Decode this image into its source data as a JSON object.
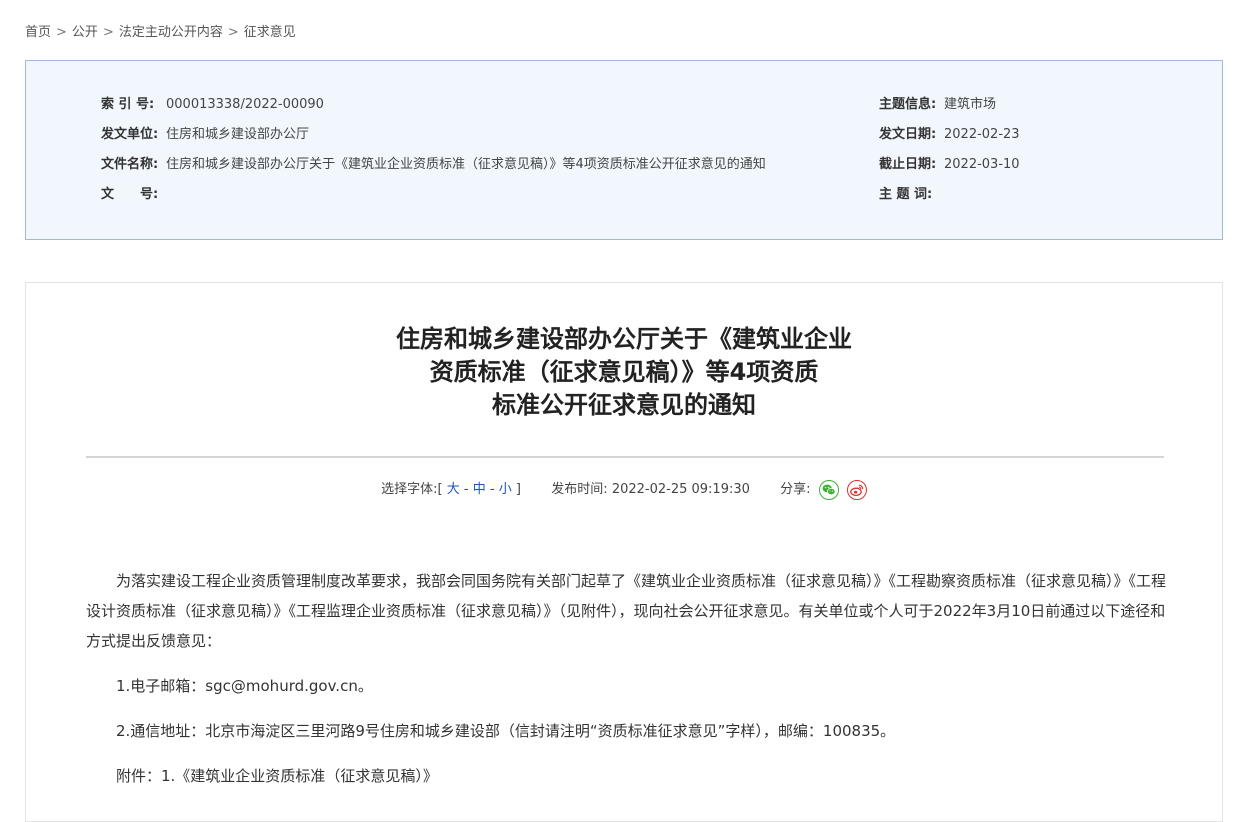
{
  "breadcrumb": {
    "items": [
      "首页",
      "公开",
      "法定主动公开内容",
      "征求意见"
    ],
    "separator": ">"
  },
  "meta": {
    "index_label": "索 引 号:",
    "index_value": "000013338/2022-00090",
    "issuer_label": "发文单位:",
    "issuer_value": "住房和城乡建设部办公厅",
    "filename_label": "文件名称:",
    "filename_value": "住房和城乡建设部办公厅关于《建筑业企业资质标准（征求意见稿）》等4项资质标准公开征求意见的通知",
    "docno_label": "文　　号:",
    "docno_value": "",
    "topic_label": "主题信息:",
    "topic_value": "建筑市场",
    "date_label": "发文日期:",
    "date_value": "2022-02-23",
    "deadline_label": "截止日期:",
    "deadline_value": "2022-03-10",
    "keywords_label": "主 题 词:",
    "keywords_value": ""
  },
  "article": {
    "title_lines": [
      "住房和城乡建设部办公厅关于《建筑业企业",
      "资质标准（征求意见稿）》等4项资质",
      "标准公开征求意见的通知"
    ],
    "font_label": "选择字体:",
    "font_open": "[",
    "font_large": "大",
    "font_medium": "中",
    "font_small": "小",
    "font_close": "]",
    "font_dash": "-",
    "publish_label": "发布时间:",
    "publish_time": "2022-02-25 09:19:30",
    "share_label": "分享:",
    "paragraphs": [
      "为落实建设工程企业资质管理制度改革要求，我部会同国务院有关部门起草了《建筑业企业资质标准（征求意见稿）》《工程勘察资质标准（征求意见稿）》《工程设计资质标准（征求意见稿）》《工程监理企业资质标准（征求意见稿）》（见附件），现向社会公开征求意见。有关单位或个人可于2022年3月10日前通过以下途径和方式提出反馈意见：",
      "1.电子邮箱：sgc@mohurd.gov.cn。",
      "2.通信地址：北京市海淀区三里河路9号住房和城乡建设部（信封请注明“资质标准征求意见”字样），邮编：100835。",
      "附件：1.《建筑业企业资质标准（征求意见稿）》"
    ]
  },
  "colors": {
    "meta_bg": "#f2f7fd",
    "meta_border": "#9fb9d9",
    "link": "#1a57b8",
    "wechat": "#3cb034",
    "weibo": "#d9322f"
  },
  "icons": {
    "share_wechat": "wechat-icon",
    "share_weibo": "weibo-icon"
  }
}
